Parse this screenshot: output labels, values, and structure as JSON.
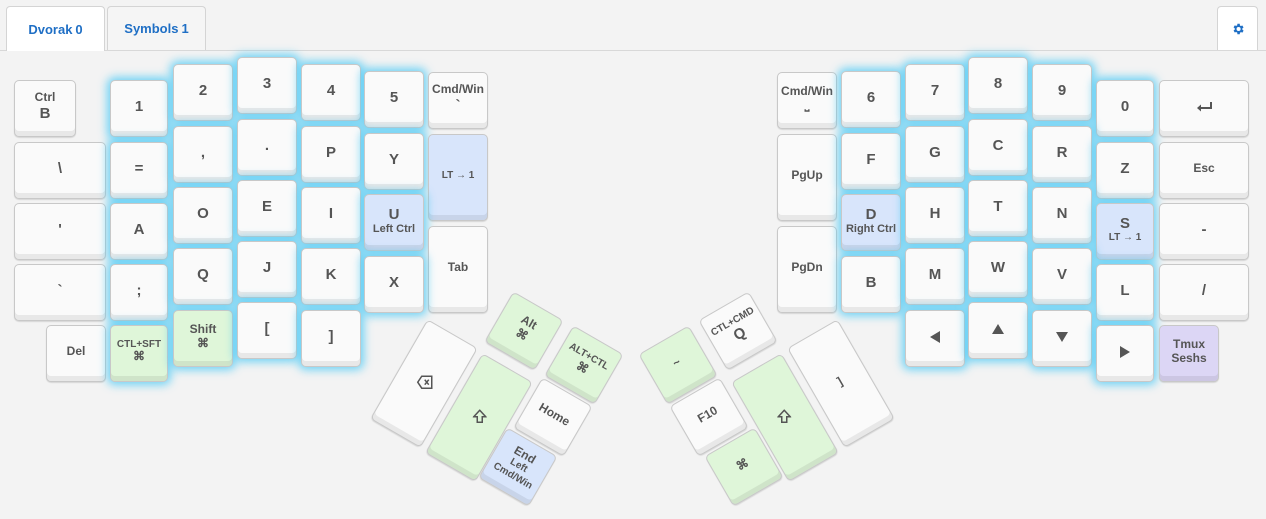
{
  "tabs": [
    {
      "label": "Dvorak",
      "count": "0"
    },
    {
      "label": "Symbols",
      "count": "1"
    }
  ],
  "settings_icon": "gear-icon",
  "colors": {
    "tab_text": "#1f6fc5",
    "glow": "#46c8f5",
    "green_key": "#dff6d9",
    "blue_key": "#d8e5fb",
    "purple_key": "#dcd6f5"
  },
  "keys": {
    "l_ctrl_b": {
      "top": "Ctrl",
      "main": "B"
    },
    "l_1": "1",
    "l_2": "2",
    "l_3": "3",
    "l_4": "4",
    "l_5": "5",
    "l_cmdwin": {
      "top": "Cmd/Win",
      "main": "`"
    },
    "l_backslash": "\\",
    "l_equals": "=",
    "l_comma": ",",
    "l_period": ".",
    "l_p": "P",
    "l_y": "Y",
    "l_lt1": "LT → 1",
    "l_quote": "'",
    "l_a": "A",
    "l_o": "O",
    "l_e": "E",
    "l_i": "I",
    "l_u": {
      "main": "U",
      "sub": "Left Ctrl"
    },
    "l_tab": "Tab",
    "l_backtick": "`",
    "l_semicolon": ";",
    "l_q": "Q",
    "l_j": "J",
    "l_k": "K",
    "l_x": "X",
    "l_del": "Del",
    "l_ctlsft": {
      "top": "CTL+SFT",
      "sym": "⌘"
    },
    "l_shift": {
      "top": "Shift",
      "sym": "⌘"
    },
    "l_lbracket": "[",
    "l_rbracket": "]",
    "lt_alt": {
      "top": "Alt",
      "sym": "⌘"
    },
    "lt_altctl": {
      "top": "ALT+CTL",
      "sym": "⌘"
    },
    "lt_backspace_icon": "backspace-icon",
    "lt_shift_icon": "shift-icon",
    "lt_home": "Home",
    "lt_end": {
      "top": "End",
      "mid": "Left",
      "bot": "Cmd/Win"
    },
    "r_cmdwin": {
      "top": "Cmd/Win",
      "main": "⎵"
    },
    "r_6": "6",
    "r_7": "7",
    "r_8": "8",
    "r_9": "9",
    "r_0": "0",
    "r_enter_icon": "enter-icon",
    "r_pgup": "PgUp",
    "r_f": "F",
    "r_g": "G",
    "r_c": "C",
    "r_r": "R",
    "r_z": "Z",
    "r_esc": "Esc",
    "r_d": {
      "main": "D",
      "sub": "Right Ctrl"
    },
    "r_h": "H",
    "r_t": "T",
    "r_n": "N",
    "r_s": {
      "main": "S",
      "sub": "LT → 1"
    },
    "r_minus": "-",
    "r_pgdn": "PgDn",
    "r_b": "B",
    "r_m": "M",
    "r_w": "W",
    "r_v": "V",
    "r_l": "L",
    "r_slash": "/",
    "r_left_icon": "arrow-left-icon",
    "r_up_icon": "arrow-up-icon",
    "r_down_icon": "arrow-down-icon",
    "r_right_icon": "arrow-right-icon",
    "r_tmux": {
      "top": "Tmux",
      "bot": "Seshs"
    },
    "rt_fn": "~",
    "rt_ctlcmd": {
      "top": "CTL+CMD",
      "main": "Q"
    },
    "rt_bracket": "]",
    "rt_f10": "F10",
    "rt_shift_icon": "shift-icon",
    "rt_cmd": "⌘"
  }
}
